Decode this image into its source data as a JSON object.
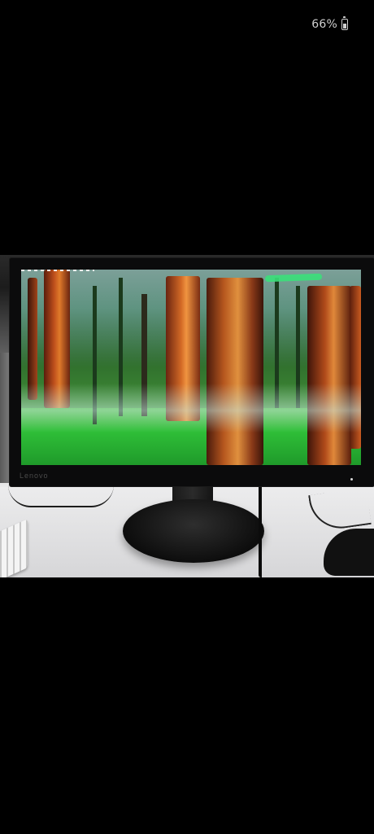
{
  "status_bar": {
    "battery_percent": "66%",
    "battery_level": 0.66,
    "battery_icon": "battery-icon"
  },
  "photo": {
    "monitor": {
      "brand": "Lenovo",
      "wallpaper": "redwood-forest"
    }
  },
  "colors": {
    "background": "#000000",
    "status_text": "#cfcfcf",
    "annotation_mark": "#3be07a"
  }
}
